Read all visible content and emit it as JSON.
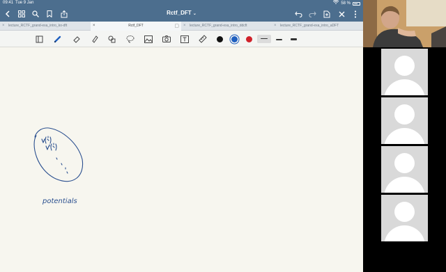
{
  "status_bar": {
    "time": "09:41",
    "date": "Tue 9 Jan",
    "battery": "58 %"
  },
  "nav": {
    "title": "Rctf_DFT",
    "left_icons": [
      "back-icon",
      "grid-icon",
      "search-icon",
      "bookmark-icon",
      "share-icon"
    ],
    "right_icons": [
      "undo-icon",
      "redo-icon",
      "export-icon",
      "close-icon",
      "more-icon"
    ]
  },
  "tabs": [
    {
      "label": "lecture_RCTF_grand-exa_intro_ko-dft",
      "active": false
    },
    {
      "label": "Rctf_DFT",
      "active": true
    },
    {
      "label": "lecture_RCTF_grand-exa_intro_ddcft",
      "active": false
    },
    {
      "label": "lecture_RCTF_grand-exa_intro_aDFT",
      "active": false
    }
  ],
  "toolbar": {
    "tools": [
      "page-layout-icon",
      "pen-icon",
      "eraser-icon",
      "highlighter-icon",
      "shapes-icon",
      "lasso-icon",
      "image-icon",
      "camera-icon",
      "text-icon",
      "ruler-icon"
    ],
    "colors": [
      "#111111",
      "#1f5fbf",
      "#d0212a"
    ],
    "active_color": "#1f5fbf"
  },
  "canvas": {
    "ink_color": "#2a4f8f",
    "annotation_text": "potentials"
  },
  "video": {
    "participant_tiles": 4
  }
}
